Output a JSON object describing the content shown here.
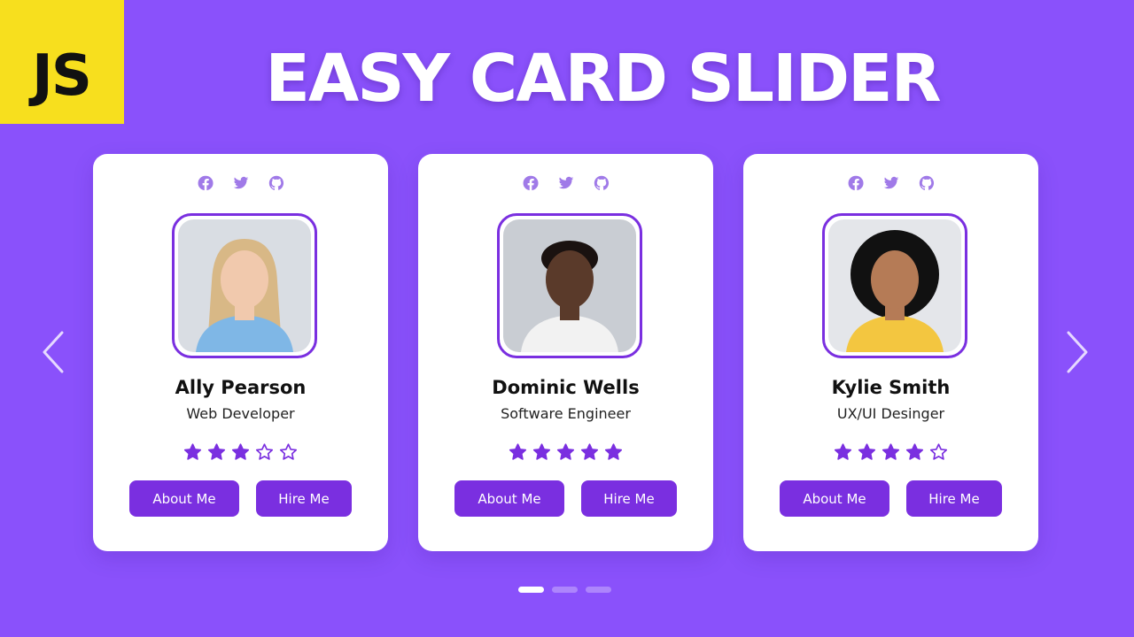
{
  "badge": {
    "text": "JS",
    "color": "#f7df1e"
  },
  "headline": "EASY CARD SLIDER",
  "theme": {
    "background": "#8a51fb",
    "accent": "#7a2fe0",
    "icon_color": "#a07ae8"
  },
  "social_icons": [
    "facebook-icon",
    "twitter-icon",
    "github-icon"
  ],
  "cards": [
    {
      "name": "Ally Pearson",
      "role": "Web Developer",
      "rating": 3,
      "max_rating": 5,
      "about_label": "About Me",
      "hire_label": "Hire Me"
    },
    {
      "name": "Dominic Wells",
      "role": "Software Engineer",
      "rating": 5,
      "max_rating": 5,
      "about_label": "About Me",
      "hire_label": "Hire Me"
    },
    {
      "name": "Kylie Smith",
      "role": "UX/UI Desinger",
      "rating": 4,
      "max_rating": 5,
      "about_label": "About Me",
      "hire_label": "Hire Me"
    }
  ],
  "navigation": {
    "prev_icon": "chevron-left-icon",
    "next_icon": "chevron-right-icon"
  },
  "pagination": {
    "pages": 3,
    "active_page": 1
  }
}
